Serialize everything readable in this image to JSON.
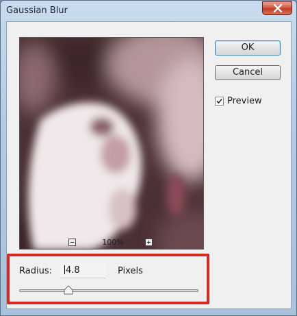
{
  "window": {
    "title": "Gaussian Blur"
  },
  "buttons": {
    "ok_label": "OK",
    "cancel_label": "Cancel"
  },
  "preview_option": {
    "label": "Preview",
    "checked": true
  },
  "zoom": {
    "level": "100%"
  },
  "radius": {
    "label": "Radius:",
    "value": "4.8",
    "unit": "Pixels"
  },
  "colors": {
    "highlight": "#d62a20",
    "titlebar": "#b9d1ea"
  }
}
